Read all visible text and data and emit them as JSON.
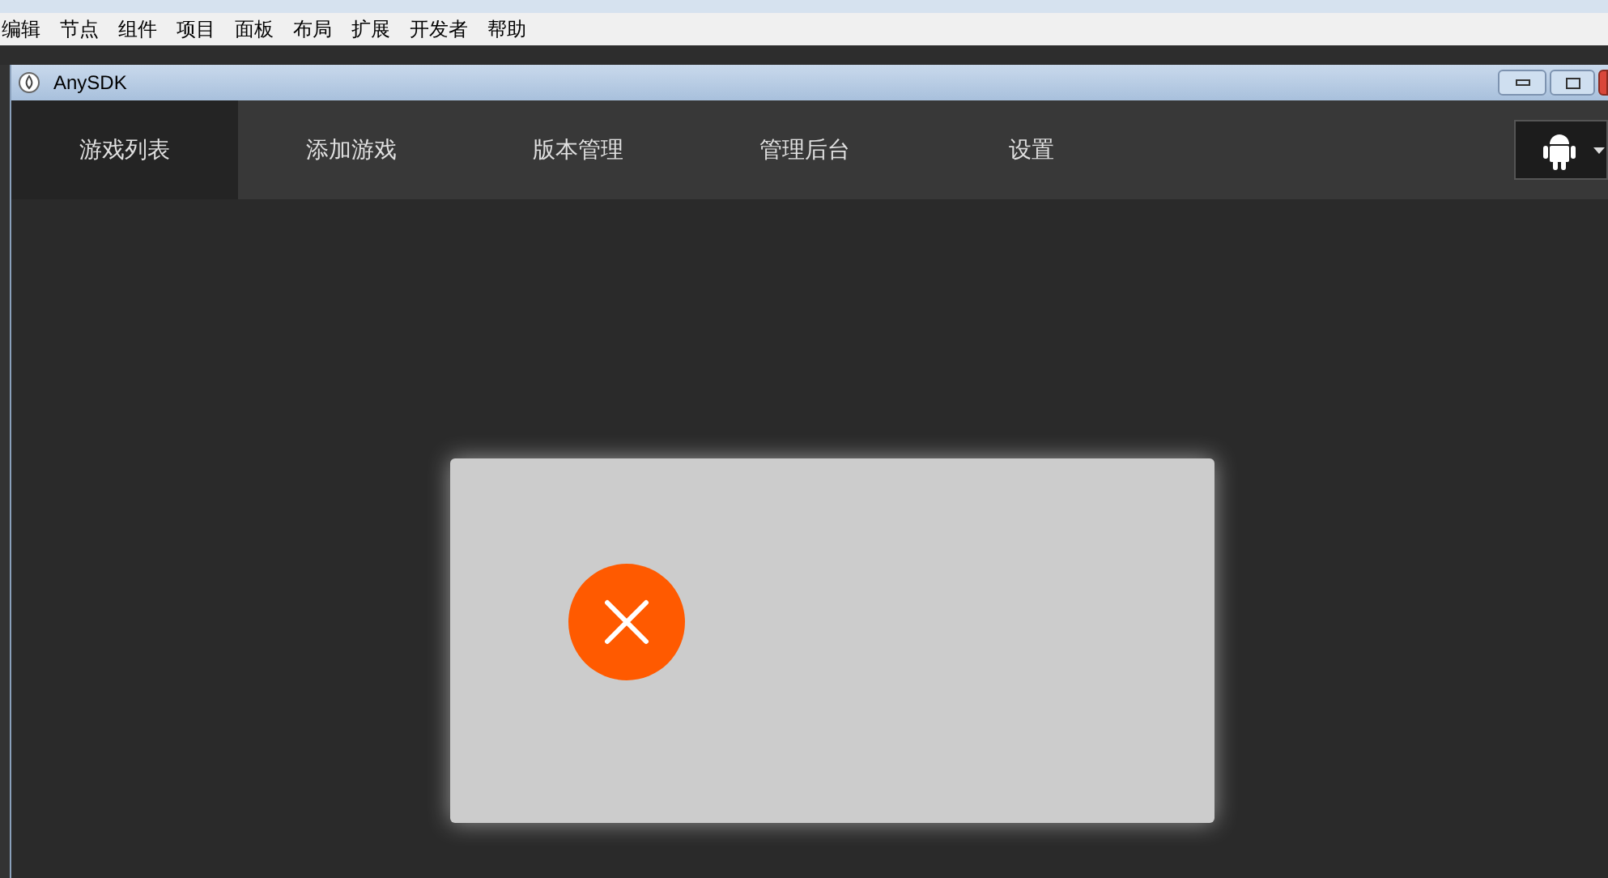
{
  "menu_bar": [
    "编辑",
    "节点",
    "组件",
    "项目",
    "面板",
    "布局",
    "扩展",
    "开发者",
    "帮助"
  ],
  "window": {
    "title": "AnySDK"
  },
  "tabs": [
    {
      "label": "游戏列表",
      "selected": true
    },
    {
      "label": "添加游戏",
      "selected": false
    },
    {
      "label": "版本管理",
      "selected": false
    },
    {
      "label": "管理后台",
      "selected": false
    },
    {
      "label": "设置",
      "selected": false
    }
  ],
  "dialog": {
    "kind": "error"
  }
}
